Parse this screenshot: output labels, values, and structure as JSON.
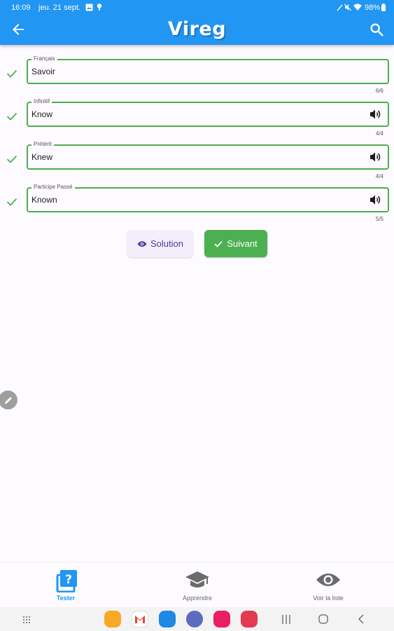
{
  "status_bar": {
    "time": "16:09",
    "date": "jeu. 21 sept.",
    "battery": "98%"
  },
  "app_bar": {
    "title": "Vireg",
    "back_icon": "arrow-back-icon",
    "search_icon": "search-icon"
  },
  "fields": [
    {
      "label": "Français",
      "value": "Savoir",
      "counter": "6/6",
      "has_audio": false
    },
    {
      "label": "Infinitif",
      "value": "Know",
      "counter": "4/4",
      "has_audio": true
    },
    {
      "label": "Prétérit",
      "value": "Knew",
      "counter": "4/4",
      "has_audio": true
    },
    {
      "label": "Participe Passé",
      "value": "Known",
      "counter": "5/5",
      "has_audio": true
    }
  ],
  "buttons": {
    "solution": "Solution",
    "next": "Suivant"
  },
  "bottom_nav": [
    {
      "label": "Tester",
      "icon": "quiz-icon",
      "active": true
    },
    {
      "label": "Apprendre",
      "icon": "graduation-cap-icon",
      "active": false
    },
    {
      "label": "Voir la liste",
      "icon": "eye-icon",
      "active": false
    }
  ],
  "colors": {
    "primary": "#2196f3",
    "success": "#4caf50",
    "solution_text": "#4a3aa0",
    "background": "#fdfbff"
  }
}
